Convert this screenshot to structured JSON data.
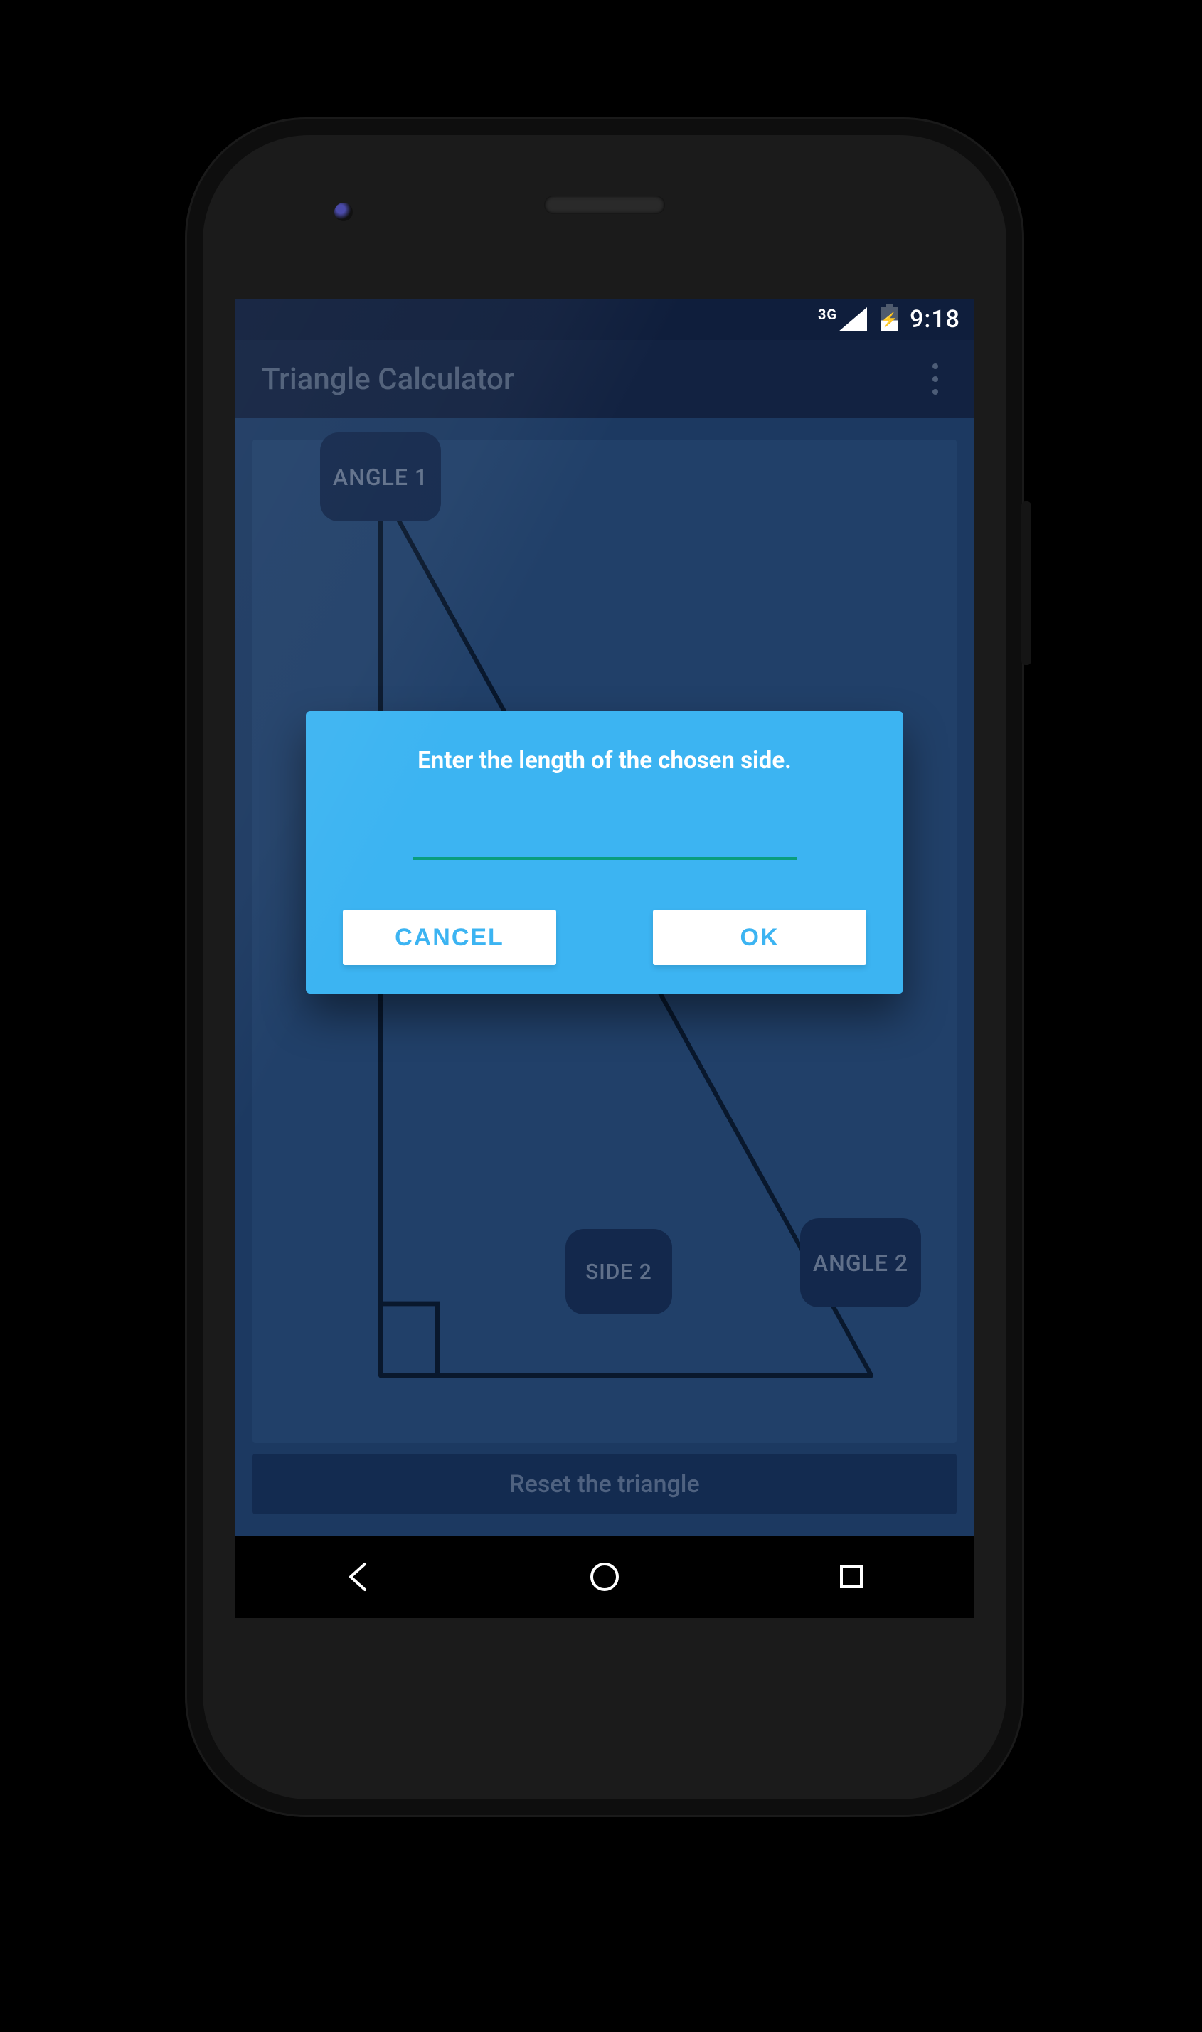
{
  "status": {
    "network": "3G",
    "time": "9:18"
  },
  "appbar": {
    "title": "Triangle Calculator"
  },
  "triangle": {
    "angle1_label": "ANGLE 1",
    "side2_label": "SIDE 2",
    "angle2_label": "ANGLE 2"
  },
  "reset_label": "Reset the triangle",
  "dialog": {
    "title": "Enter the length of the chosen side.",
    "input_value": "",
    "cancel_label": "CANCEL",
    "ok_label": "OK"
  }
}
